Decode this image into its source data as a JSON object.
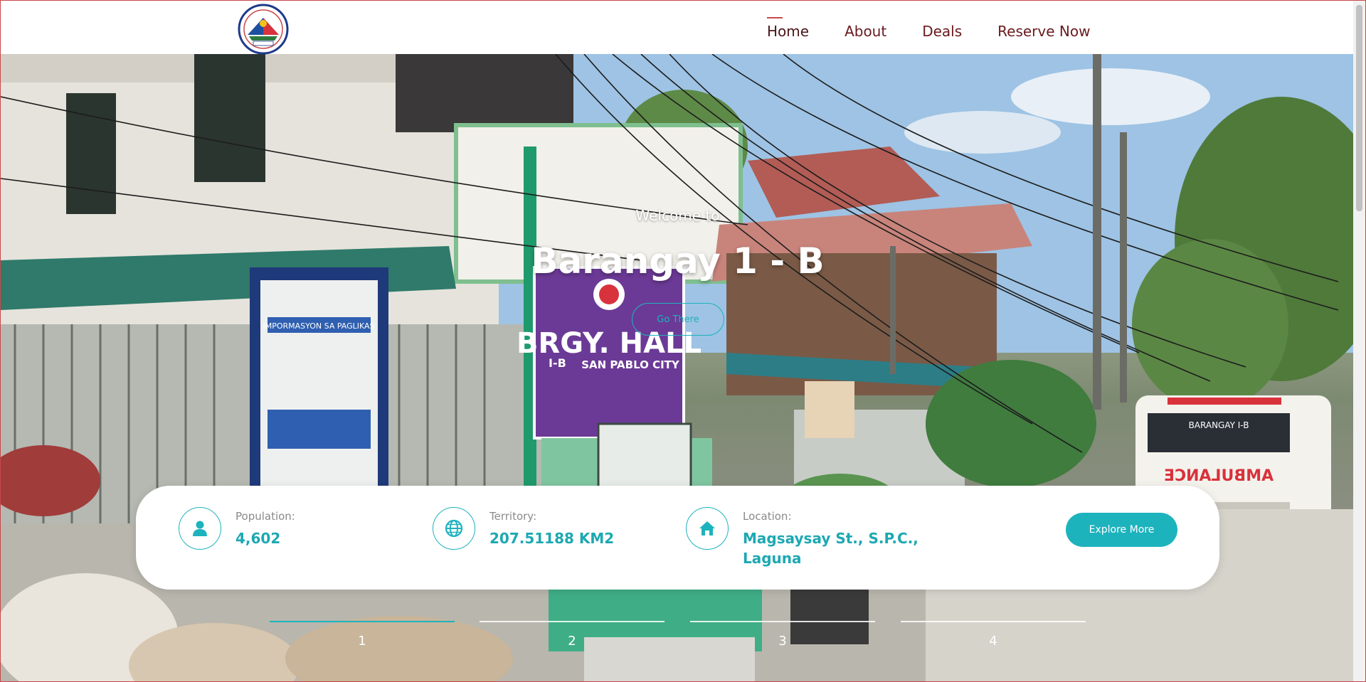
{
  "header": {
    "logo_text": "BARANGAY I-B SAN PABLO CITY OFFICIAL SEAL",
    "nav": [
      {
        "label": "Home",
        "active": true
      },
      {
        "label": "About",
        "active": false
      },
      {
        "label": "Deals",
        "active": false
      },
      {
        "label": "Reserve Now",
        "active": false
      }
    ]
  },
  "hero": {
    "welcome": "Welcome to",
    "title": "Barangay 1 - B",
    "cta": "Go There",
    "scene_signs": {
      "hall_sign_line1": "BRGY. HALL",
      "hall_sign_line2": "SAN PABLO CITY",
      "hall_sign_prefix": "I-B",
      "board_title": "IMPORMASYON SA PAGLIKAS",
      "ambulance_top": "BARANGAY I-B",
      "ambulance_front": "AMBULANCE"
    }
  },
  "info": {
    "population": {
      "label": "Population:",
      "value": "4,602",
      "icon": "person-icon"
    },
    "territory": {
      "label": "Territory:",
      "value": "207.51188 KM2",
      "icon": "globe-icon"
    },
    "location": {
      "label": "Location:",
      "value_line1": "Magsaysay St., S.P.C.,",
      "value_line2": "Laguna",
      "icon": "home-icon"
    },
    "explore_label": "Explore More"
  },
  "pager": [
    {
      "label": "1",
      "active": true
    },
    {
      "label": "2",
      "active": false
    },
    {
      "label": "3",
      "active": false
    },
    {
      "label": "4",
      "active": false
    }
  ],
  "colors": {
    "accent": "#1db3bd",
    "nav_text": "#6a1a1f",
    "nav_active_bar": "#c9484b",
    "value_text": "#1da8b2"
  }
}
